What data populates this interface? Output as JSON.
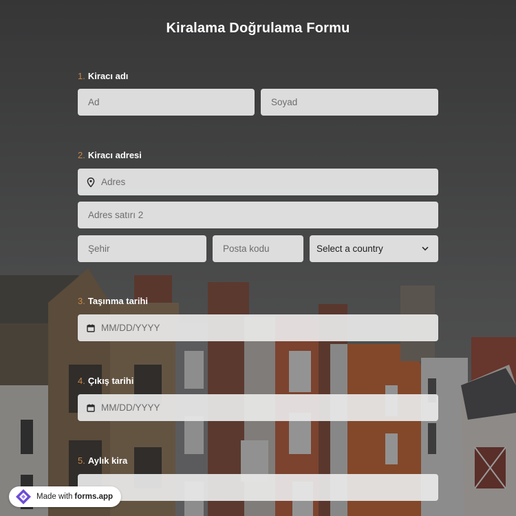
{
  "form": {
    "title": "Kiralama Doğrulama Formu",
    "q1": {
      "num": "1.",
      "label": "Kiracı adı",
      "first_placeholder": "Ad",
      "last_placeholder": "Soyad"
    },
    "q2": {
      "num": "2.",
      "label": "Kiracı adresi",
      "address_placeholder": "Adres",
      "address2_placeholder": "Adres satırı 2",
      "city_placeholder": "Şehir",
      "zip_placeholder": "Posta kodu",
      "country_value": "Select a country",
      "address_icon": "map-pin-icon",
      "country_icon": "chevron-down-icon"
    },
    "q3": {
      "num": "3.",
      "label": "Taşınma tarihi",
      "placeholder": "MM/DD/YYYY",
      "icon": "calendar-icon"
    },
    "q4": {
      "num": "4.",
      "label": "Çıkış tarihi",
      "placeholder": "MM/DD/YYYY",
      "icon": "calendar-icon"
    },
    "q5": {
      "num": "5.",
      "label": "Aylık kira"
    }
  },
  "badge": {
    "prefix": "Made with",
    "brand": "forms.app",
    "icon": "forms-app-logo-icon"
  },
  "colors": {
    "accent": "#c5874a",
    "field_bg": "#e8e8e8",
    "brand": "#6c4cd6"
  }
}
